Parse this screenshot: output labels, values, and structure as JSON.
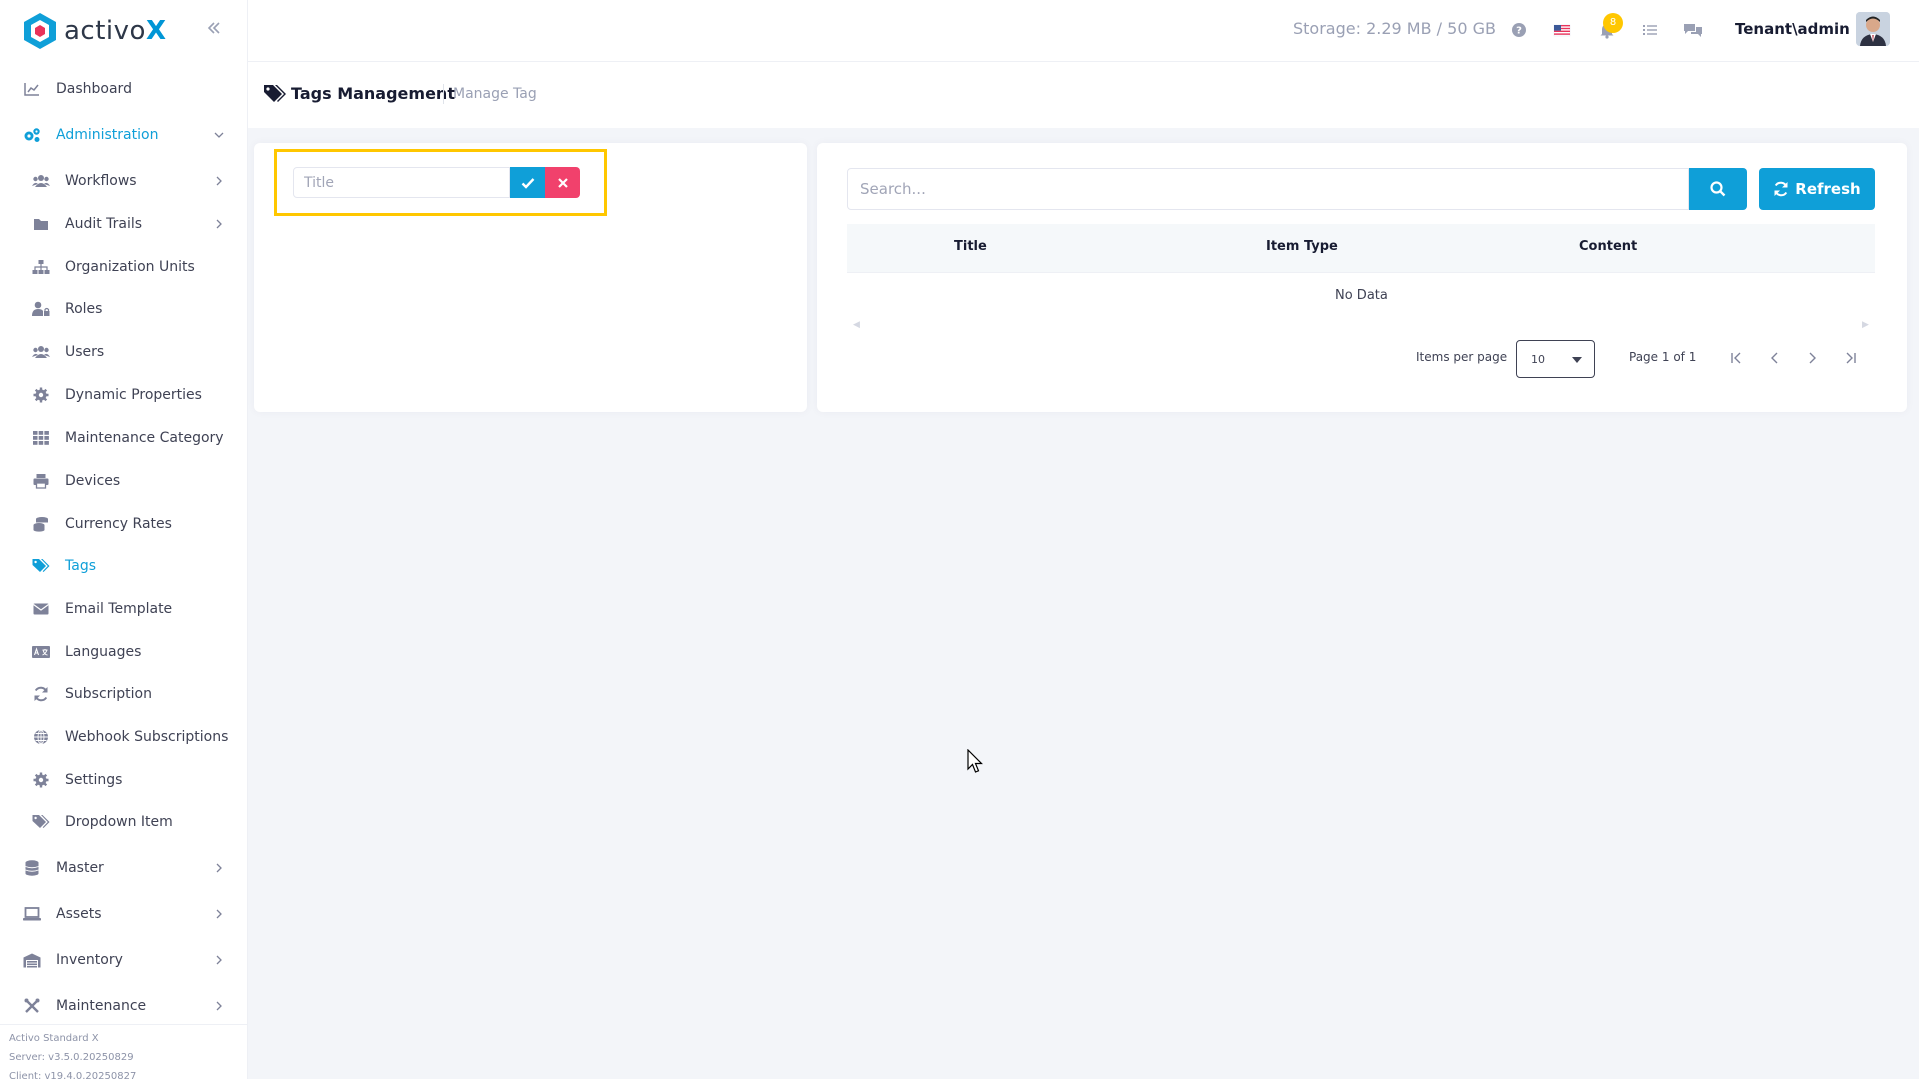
{
  "brand": {
    "name_prefix": "activo",
    "name_suffix": "X"
  },
  "sidebar": {
    "items": [
      {
        "label": "Dashboard",
        "icon": "chart-line-icon"
      },
      {
        "label": "Administration",
        "icon": "cogs-icon"
      },
      {
        "label": "Workflows",
        "icon": "users-icon"
      },
      {
        "label": "Audit Trails",
        "icon": "folder-icon"
      },
      {
        "label": "Organization Units",
        "icon": "sitemap-icon"
      },
      {
        "label": "Roles",
        "icon": "user-lock-icon"
      },
      {
        "label": "Users",
        "icon": "users-icon"
      },
      {
        "label": "Dynamic Properties",
        "icon": "cog-icon"
      },
      {
        "label": "Maintenance Category",
        "icon": "th-icon"
      },
      {
        "label": "Devices",
        "icon": "print-icon"
      },
      {
        "label": "Currency Rates",
        "icon": "coins-icon"
      },
      {
        "label": "Tags",
        "icon": "tags-icon"
      },
      {
        "label": "Email Template",
        "icon": "envelope-icon"
      },
      {
        "label": "Languages",
        "icon": "language-icon"
      },
      {
        "label": "Subscription",
        "icon": "sync-icon"
      },
      {
        "label": "Webhook Subscriptions",
        "icon": "globe-icon"
      },
      {
        "label": "Settings",
        "icon": "cog-icon"
      },
      {
        "label": "Dropdown Item",
        "icon": "tags-icon"
      },
      {
        "label": "Master",
        "icon": "database-icon"
      },
      {
        "label": "Assets",
        "icon": "laptop-icon"
      },
      {
        "label": "Inventory",
        "icon": "warehouse-icon"
      },
      {
        "label": "Maintenance",
        "icon": "tools-icon"
      }
    ],
    "footer": {
      "product": "Activo Standard X",
      "server": "Server: v3.5.0.20250829",
      "client": "Client: v19.4.0.20250827"
    }
  },
  "topbar": {
    "storage": "Storage: 2.29 MB / 50 GB",
    "notification_count": "8",
    "user": "Tenant\\admin"
  },
  "header": {
    "title": "Tags Management",
    "subtitle": "Manage Tag"
  },
  "form": {
    "title_placeholder": "Title"
  },
  "list": {
    "search_placeholder": "Search...",
    "refresh_label": "Refresh",
    "columns": [
      "Title",
      "Item Type",
      "Content"
    ],
    "empty_text": "No Data",
    "items_per_page_label": "Items per page",
    "items_per_page_value": "10",
    "page_info": "Page 1 of 1"
  },
  "colors": {
    "accent": "#0f9fd8",
    "danger": "#f1416c",
    "highlight": "#ffc700"
  }
}
